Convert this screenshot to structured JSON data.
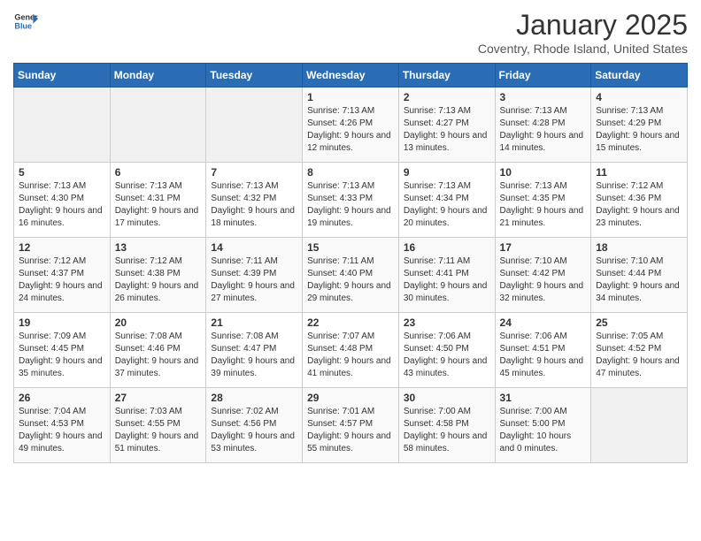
{
  "header": {
    "logo_general": "General",
    "logo_blue": "Blue",
    "month_title": "January 2025",
    "location": "Coventry, Rhode Island, United States"
  },
  "days_of_week": [
    "Sunday",
    "Monday",
    "Tuesday",
    "Wednesday",
    "Thursday",
    "Friday",
    "Saturday"
  ],
  "weeks": [
    [
      {
        "day": "",
        "empty": true
      },
      {
        "day": "",
        "empty": true
      },
      {
        "day": "",
        "empty": true
      },
      {
        "day": "1",
        "sunrise": "7:13 AM",
        "sunset": "4:26 PM",
        "daylight": "9 hours and 12 minutes."
      },
      {
        "day": "2",
        "sunrise": "7:13 AM",
        "sunset": "4:27 PM",
        "daylight": "9 hours and 13 minutes."
      },
      {
        "day": "3",
        "sunrise": "7:13 AM",
        "sunset": "4:28 PM",
        "daylight": "9 hours and 14 minutes."
      },
      {
        "day": "4",
        "sunrise": "7:13 AM",
        "sunset": "4:29 PM",
        "daylight": "9 hours and 15 minutes."
      }
    ],
    [
      {
        "day": "5",
        "sunrise": "7:13 AM",
        "sunset": "4:30 PM",
        "daylight": "9 hours and 16 minutes."
      },
      {
        "day": "6",
        "sunrise": "7:13 AM",
        "sunset": "4:31 PM",
        "daylight": "9 hours and 17 minutes."
      },
      {
        "day": "7",
        "sunrise": "7:13 AM",
        "sunset": "4:32 PM",
        "daylight": "9 hours and 18 minutes."
      },
      {
        "day": "8",
        "sunrise": "7:13 AM",
        "sunset": "4:33 PM",
        "daylight": "9 hours and 19 minutes."
      },
      {
        "day": "9",
        "sunrise": "7:13 AM",
        "sunset": "4:34 PM",
        "daylight": "9 hours and 20 minutes."
      },
      {
        "day": "10",
        "sunrise": "7:13 AM",
        "sunset": "4:35 PM",
        "daylight": "9 hours and 21 minutes."
      },
      {
        "day": "11",
        "sunrise": "7:12 AM",
        "sunset": "4:36 PM",
        "daylight": "9 hours and 23 minutes."
      }
    ],
    [
      {
        "day": "12",
        "sunrise": "7:12 AM",
        "sunset": "4:37 PM",
        "daylight": "9 hours and 24 minutes."
      },
      {
        "day": "13",
        "sunrise": "7:12 AM",
        "sunset": "4:38 PM",
        "daylight": "9 hours and 26 minutes."
      },
      {
        "day": "14",
        "sunrise": "7:11 AM",
        "sunset": "4:39 PM",
        "daylight": "9 hours and 27 minutes."
      },
      {
        "day": "15",
        "sunrise": "7:11 AM",
        "sunset": "4:40 PM",
        "daylight": "9 hours and 29 minutes."
      },
      {
        "day": "16",
        "sunrise": "7:11 AM",
        "sunset": "4:41 PM",
        "daylight": "9 hours and 30 minutes."
      },
      {
        "day": "17",
        "sunrise": "7:10 AM",
        "sunset": "4:42 PM",
        "daylight": "9 hours and 32 minutes."
      },
      {
        "day": "18",
        "sunrise": "7:10 AM",
        "sunset": "4:44 PM",
        "daylight": "9 hours and 34 minutes."
      }
    ],
    [
      {
        "day": "19",
        "sunrise": "7:09 AM",
        "sunset": "4:45 PM",
        "daylight": "9 hours and 35 minutes."
      },
      {
        "day": "20",
        "sunrise": "7:08 AM",
        "sunset": "4:46 PM",
        "daylight": "9 hours and 37 minutes."
      },
      {
        "day": "21",
        "sunrise": "7:08 AM",
        "sunset": "4:47 PM",
        "daylight": "9 hours and 39 minutes."
      },
      {
        "day": "22",
        "sunrise": "7:07 AM",
        "sunset": "4:48 PM",
        "daylight": "9 hours and 41 minutes."
      },
      {
        "day": "23",
        "sunrise": "7:06 AM",
        "sunset": "4:50 PM",
        "daylight": "9 hours and 43 minutes."
      },
      {
        "day": "24",
        "sunrise": "7:06 AM",
        "sunset": "4:51 PM",
        "daylight": "9 hours and 45 minutes."
      },
      {
        "day": "25",
        "sunrise": "7:05 AM",
        "sunset": "4:52 PM",
        "daylight": "9 hours and 47 minutes."
      }
    ],
    [
      {
        "day": "26",
        "sunrise": "7:04 AM",
        "sunset": "4:53 PM",
        "daylight": "9 hours and 49 minutes."
      },
      {
        "day": "27",
        "sunrise": "7:03 AM",
        "sunset": "4:55 PM",
        "daylight": "9 hours and 51 minutes."
      },
      {
        "day": "28",
        "sunrise": "7:02 AM",
        "sunset": "4:56 PM",
        "daylight": "9 hours and 53 minutes."
      },
      {
        "day": "29",
        "sunrise": "7:01 AM",
        "sunset": "4:57 PM",
        "daylight": "9 hours and 55 minutes."
      },
      {
        "day": "30",
        "sunrise": "7:00 AM",
        "sunset": "4:58 PM",
        "daylight": "9 hours and 58 minutes."
      },
      {
        "day": "31",
        "sunrise": "7:00 AM",
        "sunset": "5:00 PM",
        "daylight": "10 hours and 0 minutes."
      },
      {
        "day": "",
        "empty": true
      }
    ]
  ],
  "labels": {
    "sunrise": "Sunrise:",
    "sunset": "Sunset:",
    "daylight": "Daylight:"
  }
}
